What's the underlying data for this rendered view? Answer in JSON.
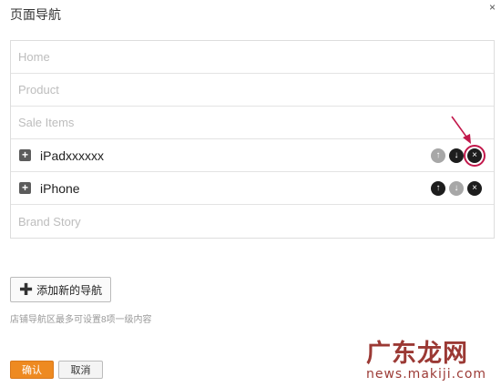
{
  "dialog": {
    "title": "页面导航",
    "close_glyph": "×"
  },
  "nav_items": [
    {
      "label": "Home"
    },
    {
      "label": "Product"
    },
    {
      "label": "Sale Items"
    },
    {
      "label": "iPadxxxxxx",
      "expand": "+",
      "up": "↑",
      "down": "↓",
      "delete": "×"
    },
    {
      "label": "iPhone",
      "expand": "+",
      "up": "↑",
      "down": "↓",
      "delete": "×"
    },
    {
      "label": "Brand Story"
    }
  ],
  "add_button": {
    "icon": "plus-icon",
    "plus_glyph": "✚",
    "label": "添加新的导航"
  },
  "hint": "店铺导航区最多可设置8项一级内容",
  "footer": {
    "ok_label": "确认",
    "cancel_label": "取消"
  },
  "watermark": {
    "top": "广东龙网",
    "bottom": "news.makiji.com"
  },
  "colors": {
    "accent": "#ee8a21",
    "highlight_ring": "#c2184b",
    "watermark": "#8e1e19"
  }
}
